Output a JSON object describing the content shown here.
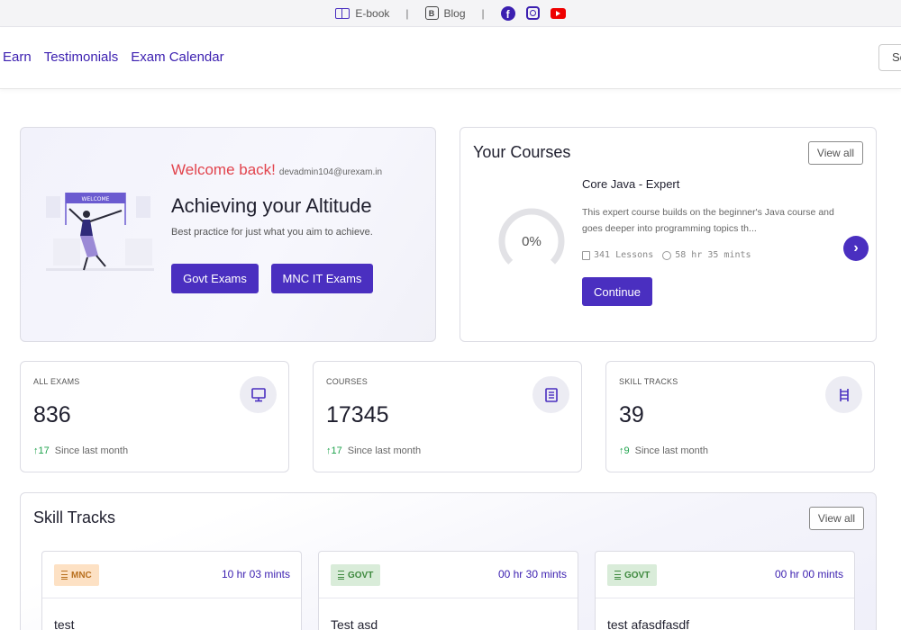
{
  "topbar": {
    "ebook_label": "E-book",
    "blog_label": "Blog",
    "separator": "|",
    "social_icons": [
      "facebook-icon",
      "instagram-icon",
      "youtube-icon"
    ]
  },
  "nav": {
    "links": [
      "Earn",
      "Testimonials",
      "Exam Calendar"
    ],
    "search_partial": "Se"
  },
  "welcome": {
    "greeting": "Welcome back!",
    "email": "devadmin104@urexam.in",
    "heading": "Achieving your Altitude",
    "subtext": "Best practice for just what you aim to achieve.",
    "banner_text": "WELCOME",
    "buttons": {
      "govt": "Govt Exams",
      "mnc": "MNC IT Exams"
    }
  },
  "courses": {
    "title": "Your Courses",
    "view_all": "View all",
    "progress_label": "0%",
    "progress": 0,
    "course_name": "Core Java - Expert",
    "description": "This expert course builds on the beginner's Java course and goes deeper into programming topics th...",
    "lessons": "341 Lessons",
    "duration": "58 hr 35 mints",
    "continue_label": "Continue"
  },
  "stats": [
    {
      "label": "ALL EXAMS",
      "value": "836",
      "delta": "17",
      "delta_text": "Since last month",
      "icon": "monitor-icon"
    },
    {
      "label": "COURSES",
      "value": "17345",
      "delta": "17",
      "delta_text": "Since last month",
      "icon": "document-icon"
    },
    {
      "label": "SKILL TRACKS",
      "value": "39",
      "delta": "9",
      "delta_text": "Since last month",
      "icon": "ladder-icon"
    }
  ],
  "skill_tracks": {
    "title": "Skill Tracks",
    "view_all": "View all",
    "items": [
      {
        "badge": "MNC",
        "time": "10 hr 03 mints",
        "name": "test"
      },
      {
        "badge": "GOVT",
        "time": "00 hr 30 mints",
        "name": "Test asd"
      },
      {
        "badge": "GOVT",
        "time": "00 hr 00 mints",
        "name": "test afasdfasdf"
      }
    ]
  },
  "colors": {
    "brand": "#4a2fc0",
    "greeting": "#e2444d",
    "positive": "#1da24b"
  }
}
